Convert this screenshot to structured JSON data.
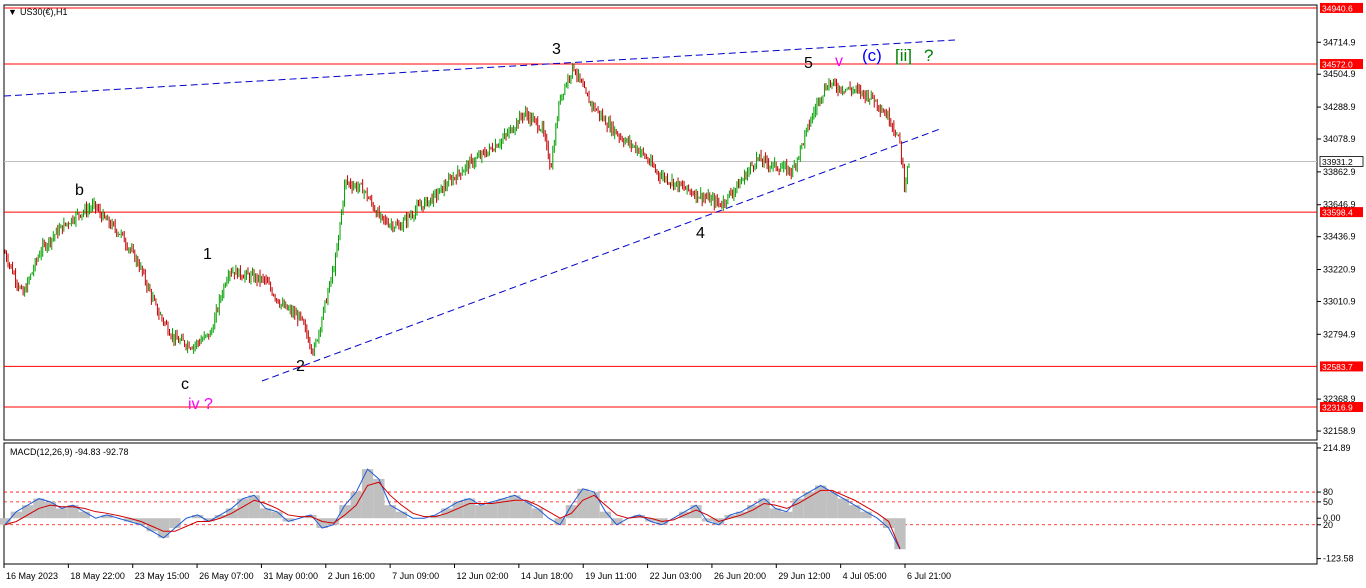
{
  "chart_data": [
    {
      "type": "candlestick",
      "title": "US30(€),H1",
      "ylim": [
        32100,
        34960
      ],
      "y_ticks": [
        "34714.9",
        "34504.9",
        "34288.9",
        "34078.9",
        "33862.9",
        "33646.9",
        "33436.9",
        "33220.9",
        "33010.9",
        "32794.9",
        "32368.9",
        "32158.9"
      ],
      "y_tick_values": [
        34714.9,
        34504.9,
        34288.9,
        34078.9,
        33862.9,
        33646.9,
        33436.9,
        33220.9,
        33010.9,
        32794.9,
        32368.9,
        32158.9
      ],
      "price_levels": [
        {
          "label": "34940.6",
          "value": 34940.6,
          "color": "#ff0000"
        },
        {
          "label": "34572.0",
          "value": 34572.0,
          "color": "#ff0000"
        },
        {
          "label": "33598.4",
          "value": 33598.4,
          "color": "#ff0000"
        },
        {
          "label": "32583.7",
          "value": 32583.7,
          "color": "#ff0000"
        },
        {
          "label": "32316.9",
          "value": 32316.9,
          "color": "#ff0000"
        }
      ],
      "current_price": {
        "label": "33931.2",
        "value": 33931.2
      },
      "x_ticks": [
        "16 May 2023",
        "18 May 22:00",
        "23 May 15:00",
        "26 May 07:00",
        "31 May 00:00",
        "2 Jun 16:00",
        "7 Jun 09:00",
        "12 Jun 02:00",
        "14 Jun 18:00",
        "19 Jun 11:00",
        "22 Jun 03:00",
        "26 Jun 20:00",
        "29 Jun 12:00",
        "4 Jul 05:00",
        "6 Jul 21:00"
      ],
      "price_path": [
        [
          0,
          33330
        ],
        [
          0.02,
          33050
        ],
        [
          0.04,
          33350
        ],
        [
          0.06,
          33480
        ],
        [
          0.08,
          33580
        ],
        [
          0.1,
          33640
        ],
        [
          0.11,
          33560
        ],
        [
          0.13,
          33450
        ],
        [
          0.15,
          33250
        ],
        [
          0.17,
          32950
        ],
        [
          0.19,
          32760
        ],
        [
          0.21,
          32720
        ],
        [
          0.23,
          32800
        ],
        [
          0.24,
          33020
        ],
        [
          0.25,
          33220
        ],
        [
          0.27,
          33180
        ],
        [
          0.29,
          33150
        ],
        [
          0.31,
          32980
        ],
        [
          0.33,
          32900
        ],
        [
          0.345,
          32680
        ],
        [
          0.36,
          33050
        ],
        [
          0.37,
          33300
        ],
        [
          0.38,
          33800
        ],
        [
          0.4,
          33750
        ],
        [
          0.42,
          33550
        ],
        [
          0.44,
          33500
        ],
        [
          0.46,
          33620
        ],
        [
          0.48,
          33700
        ],
        [
          0.5,
          33820
        ],
        [
          0.52,
          33920
        ],
        [
          0.54,
          34000
        ],
        [
          0.56,
          34100
        ],
        [
          0.58,
          34250
        ],
        [
          0.6,
          34150
        ],
        [
          0.61,
          33900
        ],
        [
          0.62,
          34350
        ],
        [
          0.635,
          34560
        ],
        [
          0.65,
          34350
        ],
        [
          0.67,
          34200
        ],
        [
          0.69,
          34080
        ],
        [
          0.71,
          34000
        ],
        [
          0.73,
          33850
        ],
        [
          0.76,
          33750
        ],
        [
          0.78,
          33700
        ],
        [
          0.8,
          33650
        ],
        [
          0.82,
          33780
        ],
        [
          0.84,
          33950
        ],
        [
          0.86,
          33900
        ],
        [
          0.88,
          33870
        ],
        [
          0.9,
          34200
        ],
        [
          0.91,
          34350
        ],
        [
          0.92,
          34450
        ],
        [
          0.93,
          34420
        ],
        [
          0.95,
          34400
        ],
        [
          0.97,
          34350
        ],
        [
          0.99,
          34200
        ],
        [
          1.0,
          34050
        ],
        [
          1.005,
          33780
        ],
        [
          1.01,
          33931
        ]
      ],
      "annotations": [
        {
          "text": "b",
          "color": "#000000"
        },
        {
          "text": "1",
          "color": "#000000"
        },
        {
          "text": "c",
          "color": "#000000"
        },
        {
          "text": "iv ?",
          "color": "#ff00ff"
        },
        {
          "text": "2",
          "color": "#000000"
        },
        {
          "text": "3",
          "color": "#000000"
        },
        {
          "text": "4",
          "color": "#000000"
        },
        {
          "text": "5",
          "color": "#000000"
        },
        {
          "text": "v",
          "color": "#ff00ff"
        },
        {
          "text": "(c)",
          "color": "#0000ff"
        },
        {
          "text": "[ii]",
          "color": "#008000"
        },
        {
          "text": "?",
          "color": "#008000"
        }
      ]
    },
    {
      "type": "line",
      "title": "MACD(12,26,9) -94.83 -92.78",
      "ylim": [
        -140,
        230
      ],
      "y_ticks": [
        "214.89",
        "80",
        "50",
        "0.00",
        "20",
        "-123.58"
      ],
      "y_tick_values": [
        214.89,
        80,
        50,
        0.0,
        -20,
        -123.58
      ],
      "levels": [
        80,
        50,
        -20
      ],
      "series": [
        {
          "name": "MACD",
          "values": [
            -20,
            20,
            40,
            60,
            50,
            30,
            40,
            20,
            0,
            10,
            0,
            -10,
            -20,
            -40,
            -60,
            -30,
            0,
            10,
            -10,
            10,
            30,
            60,
            70,
            30,
            20,
            -10,
            0,
            10,
            -30,
            -20,
            40,
            80,
            150,
            120,
            40,
            20,
            0,
            0,
            10,
            30,
            50,
            60,
            40,
            50,
            60,
            70,
            50,
            30,
            0,
            -20,
            40,
            90,
            80,
            20,
            -20,
            0,
            10,
            -10,
            -20,
            0,
            20,
            40,
            -10,
            -20,
            10,
            20,
            40,
            60,
            30,
            20,
            60,
            80,
            100,
            80,
            60,
            40,
            20,
            0,
            -30,
            -94.83
          ]
        },
        {
          "name": "Signal",
          "values": [
            -20,
            -10,
            10,
            30,
            40,
            35,
            35,
            30,
            20,
            15,
            8,
            0,
            -10,
            -25,
            -40,
            -40,
            -25,
            -10,
            -10,
            0,
            15,
            35,
            55,
            45,
            30,
            10,
            5,
            5,
            -10,
            -15,
            10,
            40,
            100,
            110,
            70,
            40,
            15,
            5,
            5,
            15,
            30,
            45,
            45,
            45,
            50,
            55,
            55,
            40,
            20,
            0,
            15,
            55,
            70,
            40,
            10,
            0,
            5,
            0,
            -10,
            -5,
            10,
            25,
            10,
            -10,
            0,
            10,
            25,
            45,
            40,
            30,
            45,
            65,
            85,
            85,
            70,
            55,
            35,
            15,
            -10,
            -92.78
          ]
        }
      ]
    }
  ]
}
